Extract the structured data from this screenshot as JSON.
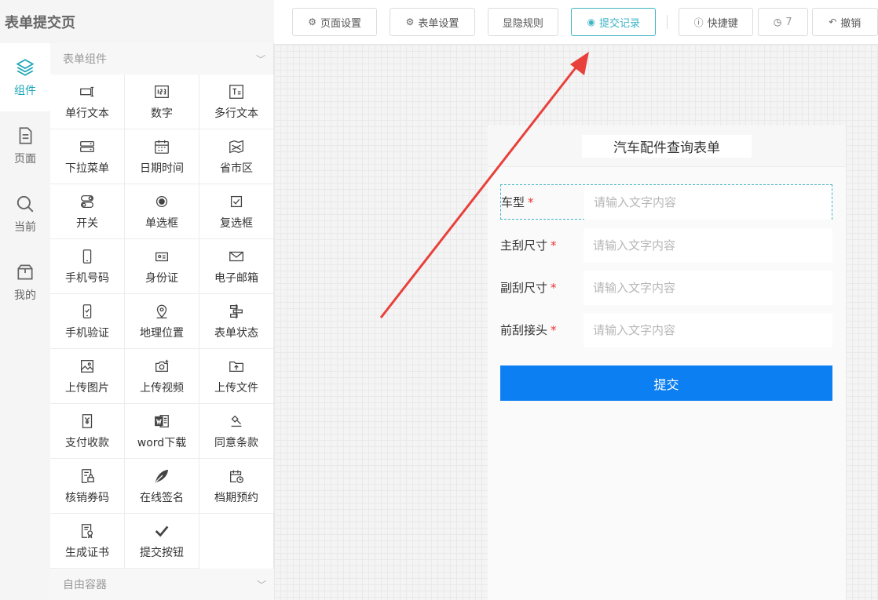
{
  "app": {
    "title": "表单提交页"
  },
  "rail": {
    "items": [
      {
        "label": "组件",
        "icon": "layers-icon"
      },
      {
        "label": "页面",
        "icon": "page-icon"
      },
      {
        "label": "当前",
        "icon": "search-icon"
      },
      {
        "label": "我的",
        "icon": "box-icon"
      }
    ]
  },
  "panel": {
    "group_title": "表单组件",
    "bottom_group_title": "自由容器",
    "components": [
      {
        "label": "单行文本",
        "icon": "single-line-icon"
      },
      {
        "label": "数字",
        "icon": "number-icon"
      },
      {
        "label": "多行文本",
        "icon": "multi-line-icon"
      },
      {
        "label": "下拉菜单",
        "icon": "dropdown-icon"
      },
      {
        "label": "日期时间",
        "icon": "calendar-icon"
      },
      {
        "label": "省市区",
        "icon": "map-icon"
      },
      {
        "label": "开关",
        "icon": "switch-icon"
      },
      {
        "label": "单选框",
        "icon": "radio-icon"
      },
      {
        "label": "复选框",
        "icon": "checkbox-icon"
      },
      {
        "label": "手机号码",
        "icon": "phone-icon"
      },
      {
        "label": "身份证",
        "icon": "id-card-icon"
      },
      {
        "label": "电子邮箱",
        "icon": "email-icon"
      },
      {
        "label": "手机验证",
        "icon": "phone-verify-icon"
      },
      {
        "label": "地理位置",
        "icon": "location-icon"
      },
      {
        "label": "表单状态",
        "icon": "form-status-icon"
      },
      {
        "label": "上传图片",
        "icon": "upload-image-icon"
      },
      {
        "label": "上传视频",
        "icon": "upload-video-icon"
      },
      {
        "label": "上传文件",
        "icon": "upload-file-icon"
      },
      {
        "label": "支付收款",
        "icon": "payment-icon"
      },
      {
        "label": "word下载",
        "icon": "word-icon"
      },
      {
        "label": "同意条款",
        "icon": "agree-terms-icon"
      },
      {
        "label": "核销券码",
        "icon": "coupon-icon"
      },
      {
        "label": "在线签名",
        "icon": "signature-icon"
      },
      {
        "label": "档期预约",
        "icon": "schedule-icon"
      },
      {
        "label": "生成证书",
        "icon": "certificate-icon"
      },
      {
        "label": "提交按钮",
        "icon": "check-icon"
      }
    ]
  },
  "toolbar": {
    "page_settings": "页面设置",
    "form_settings": "表单设置",
    "visibility_rules": "显隐规则",
    "submit_records": "提交记录",
    "shortcuts": "快捷键",
    "history_count": "7",
    "undo": "撤销"
  },
  "form": {
    "title": "汽车配件查询表单",
    "required_mark": "*",
    "fields": [
      {
        "label": "车型",
        "placeholder": "请输入文字内容"
      },
      {
        "label": "主刮尺寸",
        "placeholder": "请输入文字内容"
      },
      {
        "label": "副刮尺寸",
        "placeholder": "请输入文字内容"
      },
      {
        "label": "前刮接头",
        "placeholder": "请输入文字内容"
      }
    ],
    "submit_label": "提交"
  },
  "colors": {
    "accent": "#3fb4c4",
    "submit": "#0c7ff2",
    "arrow": "#e8403a"
  }
}
